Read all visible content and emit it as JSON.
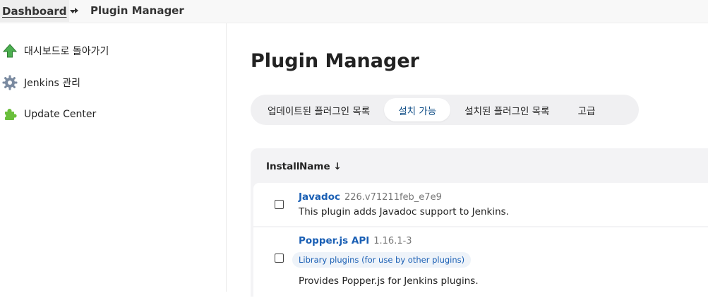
{
  "breadcrumb": {
    "root_label": "Dashboard",
    "current_label": "Plugin Manager"
  },
  "sidebar": {
    "items": [
      {
        "label": "대시보드로 돌아가기",
        "icon": "arrow-up-icon"
      },
      {
        "label": "Jenkins 관리",
        "icon": "gear-icon"
      },
      {
        "label": "Update Center",
        "icon": "puzzle-icon"
      }
    ]
  },
  "main": {
    "title": "Plugin Manager",
    "tabs": [
      {
        "label": "업데이트된 플러그인 목록",
        "active": false
      },
      {
        "label": "설치 가능",
        "active": true
      },
      {
        "label": "설치된 플러그인 목록",
        "active": false
      },
      {
        "label": "고급",
        "active": false
      }
    ],
    "table": {
      "headers": {
        "install": "Install",
        "name": "Name ↓"
      },
      "rows": [
        {
          "name": "Javadoc",
          "version": "226.v71211feb_e7e9",
          "description": "This plugin adds Javadoc support to Jenkins.",
          "checked": false
        },
        {
          "name": "Popper.js API",
          "version": "1.16.1-3",
          "tag": "Library plugins (for use by other plugins)",
          "description": "Provides Popper.js for Jenkins plugins.",
          "checked": false
        }
      ]
    }
  },
  "colors": {
    "link": "#1a5fb4",
    "active_tab_text": "#104e87",
    "tab_bar_bg": "#f0f0f2",
    "arrow_icon": "#4caf50",
    "puzzle_icon": "#6abf3b",
    "gear_icon": "#7a8aa0"
  }
}
